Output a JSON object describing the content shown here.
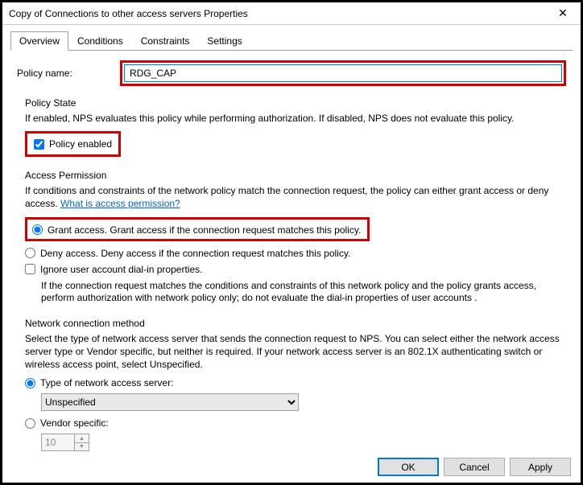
{
  "window": {
    "title": "Copy of Connections to other access servers Properties"
  },
  "tabs": {
    "overview": "Overview",
    "conditions": "Conditions",
    "constraints": "Constraints",
    "settings": "Settings"
  },
  "policyName": {
    "label": "Policy name:",
    "value": "RDG_CAP"
  },
  "policyState": {
    "title": "Policy State",
    "desc": "If enabled, NPS evaluates this policy while performing authorization. If disabled, NPS does not evaluate this policy.",
    "checkboxLabel": "Policy enabled"
  },
  "accessPermission": {
    "title": "Access Permission",
    "desc1": "If conditions and constraints of the network policy match the connection request, the policy can either grant access or deny access. ",
    "link": "What is access permission?",
    "grantLabel": "Grant access. Grant access if the connection request matches this policy.",
    "denyLabel": "Deny access. Deny access if the connection request matches this policy.",
    "ignoreLabel": "Ignore user account dial-in properties.",
    "ignoreDesc": "If the connection request matches the conditions and constraints of this network policy and the policy grants access, perform authorization with network policy only; do not evaluate the dial-in properties of user accounts ."
  },
  "networkConnection": {
    "title": "Network connection method",
    "desc": "Select the type of network access server that sends the connection request to NPS. You can select either the network access server type or Vendor specific, but neither is required.  If your network access server is an 802.1X authenticating switch or wireless access point, select Unspecified.",
    "typeLabel": "Type of network access server:",
    "typeValue": "Unspecified",
    "vendorLabel": "Vendor specific:",
    "vendorValue": "10"
  },
  "buttons": {
    "ok": "OK",
    "cancel": "Cancel",
    "apply": "Apply"
  }
}
